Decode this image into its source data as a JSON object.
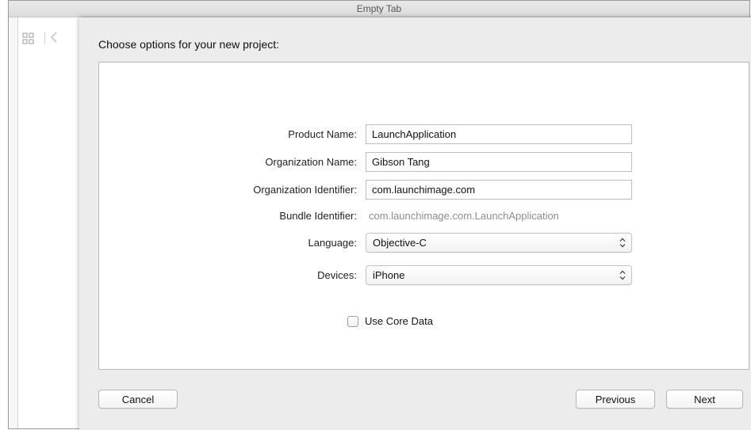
{
  "window": {
    "title": "Empty Tab"
  },
  "jump_bar": {
    "icons": [
      "grid-icon",
      "chevron-left-icon"
    ]
  },
  "sheet": {
    "title": "Choose options for your new project:"
  },
  "form": {
    "product_name": {
      "label": "Product Name:",
      "value": "LaunchApplication"
    },
    "organization_name": {
      "label": "Organization Name:",
      "value": "Gibson Tang"
    },
    "organization_identifier": {
      "label": "Organization Identifier:",
      "value": "com.launchimage.com"
    },
    "bundle_identifier": {
      "label": "Bundle Identifier:",
      "value": "com.launchimage.com.LaunchApplication"
    },
    "language": {
      "label": "Language:",
      "selected": "Objective-C"
    },
    "devices": {
      "label": "Devices:",
      "selected": "iPhone"
    },
    "use_core_data": {
      "label": "Use Core Data",
      "checked": false
    }
  },
  "buttons": {
    "cancel": "Cancel",
    "previous": "Previous",
    "next": "Next"
  },
  "colors": {
    "sheet_background": "#ececec",
    "panel_background": "#ffffff",
    "secondary_text": "#8c8c8c"
  }
}
